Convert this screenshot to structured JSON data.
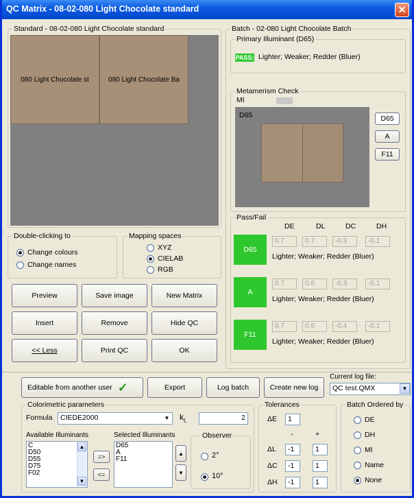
{
  "title": "QC Matrix - 08-02-080  Light Chocolate standard",
  "close_glyph": "✕",
  "standard": {
    "legend": "Standard - 08-02-080  Light Chocolate standard",
    "cell1": "080  Light Chocolate st",
    "cell2": "080  Light Chocolate Ba",
    "color": "#a79078"
  },
  "batch": {
    "legend": "Batch - 02-080  Light Chocolate Batch",
    "primary_legend": "Primary Illuminant (D65)",
    "pass": "PASS:",
    "pass_text": "Lighter; Weaker; Redder (Bluer)"
  },
  "metamerism": {
    "legend": "Metamerism Check",
    "mi": "MI",
    "panel_label": "D65",
    "buttons": [
      "D65",
      "A",
      "F11"
    ]
  },
  "double_click": {
    "legend": "Double-clicking to",
    "options": [
      "Change colours",
      "Change names"
    ],
    "selected": 0
  },
  "mapping": {
    "legend": "Mapping spaces",
    "options": [
      "XYZ",
      "CIELAB",
      "RGB"
    ],
    "selected": 1
  },
  "buttons": {
    "preview": "Preview",
    "save_image": "Save image",
    "new_matrix": "New Matrix",
    "insert": "Insert",
    "remove": "Remove",
    "hide_qc": "Hide QC",
    "less": "<< Less",
    "print_qc": "Print QC",
    "ok": "OK"
  },
  "passfail": {
    "legend": "Pass/Fail",
    "headers": [
      "DE",
      "DL",
      "DC",
      "DH"
    ],
    "rows": [
      {
        "illum": "D65",
        "values": [
          "0.7",
          "0.7",
          "-0.3",
          "-0.1"
        ],
        "text": "Lighter; Weaker; Redder (Bluer)"
      },
      {
        "illum": "A",
        "values": [
          "0.7",
          "0.6",
          "-0.3",
          "-0.1"
        ],
        "text": "Lighter; Weaker; Redder (Bluer)"
      },
      {
        "illum": "F11",
        "values": [
          "0.7",
          "0.6",
          "-0.4",
          "-0.1"
        ],
        "text": "Lighter; Weaker; Redder (Bluer)"
      }
    ]
  },
  "editable": {
    "label": "Editable from another user",
    "check": "✓"
  },
  "export": "Export",
  "log_batch": "Log batch",
  "create_log": "Create new log",
  "log_file": {
    "label": "Current log file:",
    "value": "QC test.QMX"
  },
  "colorimetric": {
    "legend": "Colorimetric parameters",
    "formula_label": "Formula",
    "formula": "CIEDE2000",
    "kl_label": "k",
    "kl_sub": "L",
    "kl_value": "2",
    "available_label": "Available Illuminants",
    "available": [
      "C",
      "D50",
      "D55",
      "D75",
      "F02"
    ],
    "selected_label": "Selected Illuminants",
    "selected": [
      "D65",
      "A",
      "F11"
    ],
    "add": "=>",
    "remove": "<="
  },
  "observer": {
    "legend": "Observer",
    "options": [
      "2°",
      "10°"
    ],
    "selected": 1
  },
  "tolerances": {
    "legend": "Tolerances",
    "de_label": "ΔE",
    "de": "1",
    "minus": "-",
    "plus": "+",
    "rows": [
      {
        "label": "ΔL",
        "lo": "-1",
        "hi": "1"
      },
      {
        "label": "ΔC",
        "lo": "-1",
        "hi": "1"
      },
      {
        "label": "ΔH",
        "lo": "-1",
        "hi": "1"
      }
    ]
  },
  "order": {
    "legend": "Batch Ordered by",
    "options": [
      "DE",
      "DH",
      "MI",
      "Name",
      "None"
    ],
    "selected": 4
  }
}
